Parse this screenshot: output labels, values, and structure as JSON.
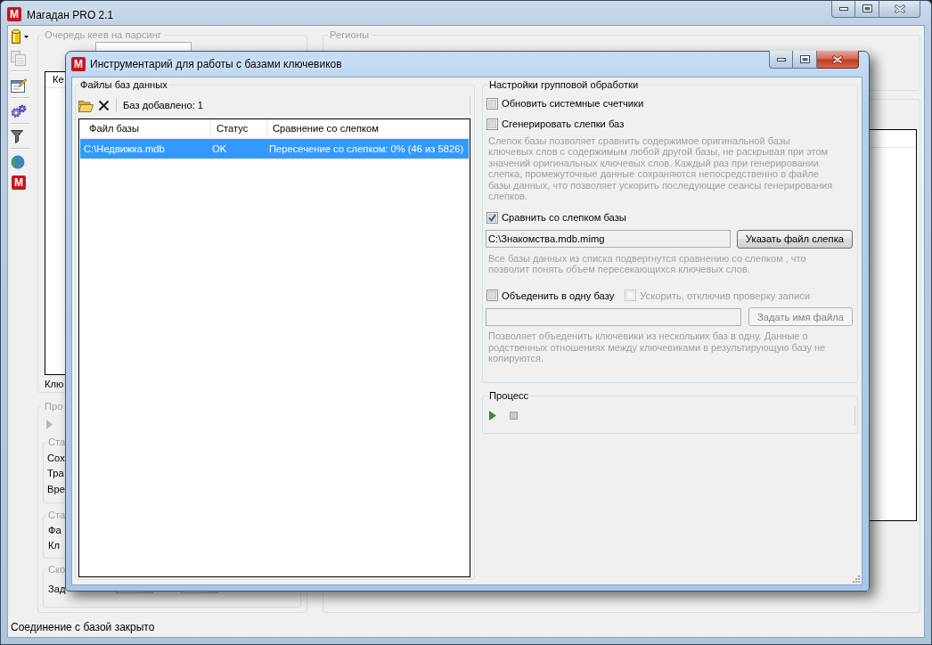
{
  "main_window": {
    "logo_text": "М",
    "title": "Магадан PRO 2.1",
    "toolbar_logo_text": "М",
    "queue_group": {
      "title": "Очередь кеев на парсинг",
      "list_column_1": "Ке",
      "footer_label": "Клю"
    },
    "process_group": {
      "title": "Про",
      "subgroups": [
        {
          "title": "Ста",
          "lines": [
            "Сох",
            "Тра",
            "Вре"
          ]
        },
        {
          "title": "Ста",
          "lines": [
            "Фа",
            "Кл"
          ]
        },
        {
          "title": "Ско",
          "lines": [
            "Зад"
          ]
        }
      ]
    },
    "regions_group": {
      "title": "Регионы"
    },
    "status_bar": "Соединение с базой закрыто"
  },
  "dialog": {
    "logo_text": "М",
    "title": "Инструментарий для работы с базами ключевиков",
    "files_group": {
      "title": "Файлы баз данных",
      "count_label": "Баз добавлено: 1",
      "table": {
        "columns": [
          "Файл базы",
          "Статус",
          "Сравнение со слепком"
        ],
        "rows": [
          {
            "cells": [
              "C:\\Недвижка.mdb",
              "OK",
              "Пересечение со слепком: 0% (46 из 5826)"
            ],
            "selected": true
          }
        ]
      }
    },
    "settings_group": {
      "title": "Настройки групповой обработки",
      "items": [
        {
          "kind": "checkboxes",
          "checkboxes": [
            {
              "label": "Обновить системные счетчики",
              "checked": false,
              "disabled": false
            }
          ]
        },
        {
          "kind": "checkboxes",
          "checkboxes": [
            {
              "label": "Сгенерировать слепки баз",
              "checked": false,
              "disabled": false
            }
          ]
        },
        {
          "kind": "note",
          "text": "Слепок базы позволяет сравнить содержимое оригинальной базы ключевых слов с содержимым любой другой базы, не раскрывая при этом значений оригинальных ключевых слов. Каждый раз при генерировании слепка, промежуточные данные сохраняются непосредственно в файле базы данных, что позволяет ускорить последующие сеансы генерирования слепков."
        },
        {
          "kind": "checkboxes",
          "checkboxes": [
            {
              "label": "Сравнить со слепком базы",
              "checked": true,
              "disabled": false
            }
          ]
        },
        {
          "kind": "file",
          "value": "C:\\Знакомства.mdb.mimg",
          "button": {
            "label": "Указать файл слепка",
            "disabled": false
          }
        },
        {
          "kind": "note",
          "text": "Все базы данных из списка подвергнутся сравнению со слепком , что позволит понять объем пересекающихся ключевых слов."
        },
        {
          "kind": "checkboxes",
          "checkboxes": [
            {
              "label": "Объеденить в одну базу",
              "checked": false,
              "disabled": false
            },
            {
              "label": "Ускорить, отключив проверку записи",
              "checked": false,
              "disabled": true
            }
          ]
        },
        {
          "kind": "file",
          "button": {
            "label": "Задать имя файла",
            "disabled": true
          }
        },
        {
          "kind": "note",
          "text": "Позволяет объеденить ключевики из нескольких баз в одну. Данные о родственных отношениях между ключевиками в результирующую базу не копируются."
        }
      ]
    },
    "process_group": {
      "title": "Процесс",
      "tools": [
        {
          "kind": "play",
          "disabled": false
        },
        {
          "kind": "stop",
          "disabled": true
        }
      ]
    }
  }
}
